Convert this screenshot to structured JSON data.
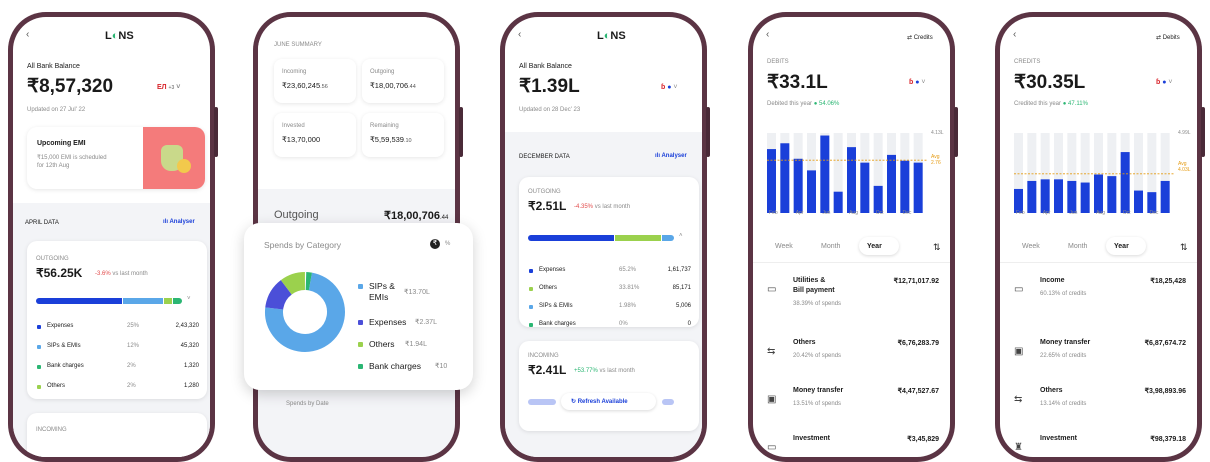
{
  "p1": {
    "logo_a": "L",
    "logo_b": "NS",
    "balance_label": "All Bank Balance",
    "balance": "₹8,57,320",
    "banks_more": "+3",
    "updated": "Updated on 27 Jul' 22",
    "emi_title": "Upcoming EMI",
    "emi_text_1": "₹15,000 EMI is scheduled",
    "emi_text_2": "for 12th Aug",
    "section": "APRIL DATA",
    "analyser": "Analyser",
    "outgoing_label": "OUTGOING",
    "outgoing_value": "₹56.25K",
    "outgoing_change": "-3.6%",
    "vs": "vs last month",
    "rows": [
      {
        "name": "Expenses",
        "pct": "25%",
        "amt": "2,43,320"
      },
      {
        "name": "SIPs & EMIs",
        "pct": "12%",
        "amt": "45,320"
      },
      {
        "name": "Bank charges",
        "pct": "2%",
        "amt": "1,320"
      },
      {
        "name": "Others",
        "pct": "2%",
        "amt": "1,280"
      }
    ],
    "incoming_label": "INCOMING"
  },
  "p2": {
    "header": "JUNE SUMMARY",
    "cells": [
      {
        "label": "Incoming",
        "value": "₹23,60,245",
        "dec": ".56"
      },
      {
        "label": "Outgoing",
        "value": "₹18,00,706",
        "dec": ".44"
      },
      {
        "label": "Invested",
        "value": "₹13,70,000",
        "dec": ""
      },
      {
        "label": "Remaining",
        "value": "₹5,59,539",
        "dec": ".10"
      }
    ],
    "outgoing_label": "Outgoing",
    "outgoing_value": "₹18,00,706",
    "outgoing_dec": ".44",
    "popup_title": "Spends by Category",
    "legend": [
      {
        "name": "SIPs &",
        "name2": "EMIs",
        "amt": "₹13.70L"
      },
      {
        "name": "Expenses",
        "name2": "",
        "amt": "₹2.37L"
      },
      {
        "name": "Others",
        "name2": "",
        "amt": "₹1.94L"
      },
      {
        "name": "Bank charges",
        "name2": "",
        "amt": "₹10"
      }
    ],
    "footer": "Spends by Date"
  },
  "p3": {
    "logo_a": "L",
    "logo_b": "NS",
    "balance_label": "All Bank Balance",
    "balance": "₹1.39L",
    "updated": "Updated on 28 Dec' 23",
    "section": "DECEMBER DATA",
    "analyser": "Analyser",
    "outgoing_label": "OUTGOING",
    "outgoing_value": "₹2.51L",
    "outgoing_change": "-4.35%",
    "vs": "vs last month",
    "rows": [
      {
        "name": "Expenses",
        "pct": "65.2%",
        "amt": "1,61,737"
      },
      {
        "name": "Others",
        "pct": "33.81%",
        "amt": "85,171"
      },
      {
        "name": "SIPs & EMIs",
        "pct": "1.98%",
        "amt": "5,006"
      },
      {
        "name": "Bank charges",
        "pct": "0%",
        "amt": "0"
      }
    ],
    "incoming_label": "INCOMING",
    "incoming_value": "₹2.41L",
    "incoming_change": "+53.77%",
    "refresh": "Refresh Available"
  },
  "p4": {
    "toggle": "Credits",
    "label": "DEBITS",
    "value": "₹33.1L",
    "sub": "Debited this year",
    "change": "54.06%",
    "ymax": "4.13L",
    "avg": "Avg",
    "avg_val": "2.76",
    "months": [
      "Feb",
      "Apr",
      "Jun",
      "Aug",
      "Oct",
      "Dec"
    ],
    "tabs": [
      "Week",
      "Month",
      "Year"
    ],
    "items": [
      {
        "name": "Utilities &",
        "name2": "Bill payment",
        "amt": "₹12,71,017.92",
        "pct": "38.39% of spends"
      },
      {
        "name": "Others",
        "name2": "",
        "amt": "₹6,76,283.79",
        "pct": "20.42% of spends"
      },
      {
        "name": "Money transfer",
        "name2": "",
        "amt": "₹4,47,527.67",
        "pct": "13.51% of spends"
      },
      {
        "name": "Investment",
        "name2": "",
        "amt": "₹3,45,829",
        "pct": ""
      }
    ]
  },
  "p5": {
    "toggle": "Debits",
    "label": "CREDITS",
    "value": "₹30.35L",
    "sub": "Credited this year",
    "change": "47.11%",
    "ymax": "4.99L",
    "avg": "Avg",
    "avg_val": "4.03L",
    "months": [
      "Feb",
      "Apr",
      "Jun",
      "Aug",
      "Oct",
      "Dec"
    ],
    "tabs": [
      "Week",
      "Month",
      "Year"
    ],
    "items": [
      {
        "name": "Income",
        "amt": "₹18,25,428",
        "pct": "60.13% of credits"
      },
      {
        "name": "Money transfer",
        "amt": "₹6,87,674.72",
        "pct": "22.65% of credits"
      },
      {
        "name": "Others",
        "amt": "₹3,98,893.96",
        "pct": "13.14% of credits"
      },
      {
        "name": "Investment",
        "amt": "₹98,379.18",
        "pct": ""
      }
    ]
  },
  "colors": {
    "accent": "#1a3fd9",
    "green": "#2bb673",
    "light_blue": "#5aa7e8",
    "lime": "#9bd14d",
    "frame": "#5b3444"
  },
  "chart_data": [
    {
      "type": "bar",
      "title": "",
      "series": [
        {
          "name": "Debits",
          "values": [
            3.3,
            3.6,
            2.8,
            2.2,
            4.0,
            1.1,
            3.4,
            2.6,
            1.4,
            3.0,
            2.7,
            2.6
          ]
        }
      ],
      "ylim": [
        0,
        4.13
      ]
    },
    {
      "type": "bar",
      "title": "",
      "series": [
        {
          "name": "Credits",
          "values": [
            1.5,
            2.0,
            2.1,
            2.1,
            2.0,
            1.9,
            2.4,
            2.3,
            3.8,
            1.4,
            1.3,
            2.0
          ]
        }
      ],
      "ylim": [
        0,
        4.99
      ]
    }
  ]
}
